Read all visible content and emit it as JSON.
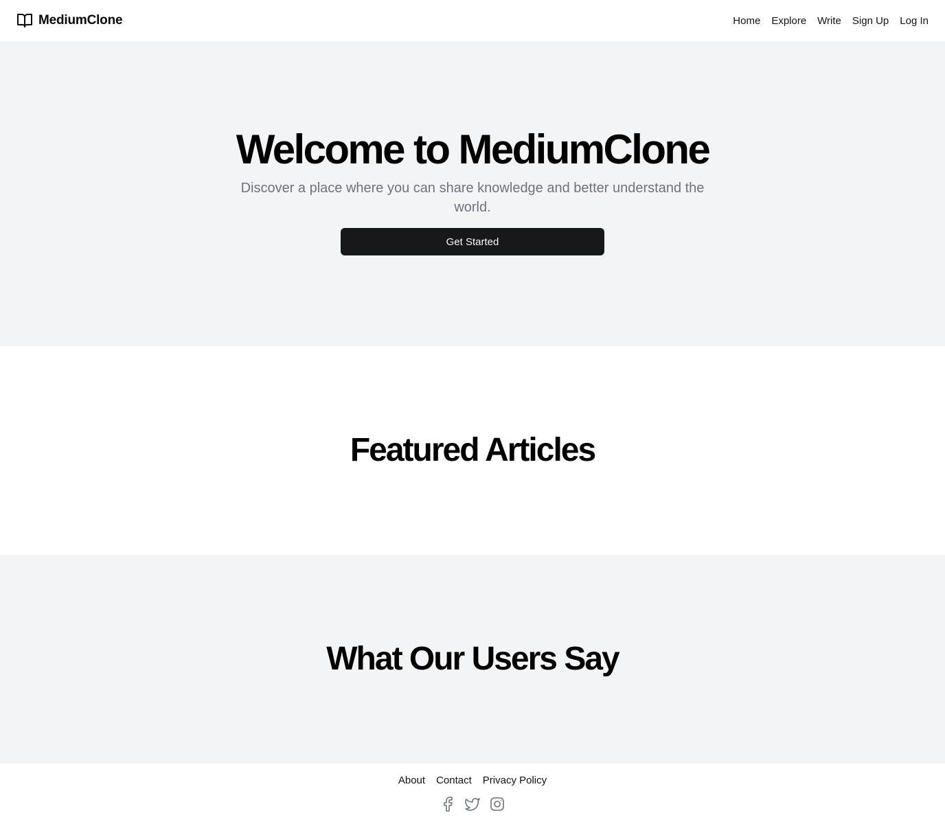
{
  "header": {
    "brand_name": "MediumClone",
    "brand_icon": "book-open-icon",
    "nav": [
      {
        "label": "Home"
      },
      {
        "label": "Explore"
      },
      {
        "label": "Write"
      },
      {
        "label": "Sign Up"
      },
      {
        "label": "Log In"
      }
    ]
  },
  "hero": {
    "title": "Welcome to MediumClone",
    "subtitle": "Discover a place where you can share knowledge and better understand the world.",
    "cta_label": "Get Started"
  },
  "featured": {
    "title": "Featured Articles"
  },
  "testimonials": {
    "title": "What Our Users Say"
  },
  "footer": {
    "links": [
      {
        "label": "About"
      },
      {
        "label": "Contact"
      },
      {
        "label": "Privacy Policy"
      }
    ],
    "socials": [
      "facebook-icon",
      "twitter-icon",
      "instagram-icon"
    ]
  },
  "colors": {
    "hero_bg": "#f3f4f6",
    "button_bg": "#18181b",
    "button_text": "#fafafa",
    "muted_text": "#6b7280"
  }
}
